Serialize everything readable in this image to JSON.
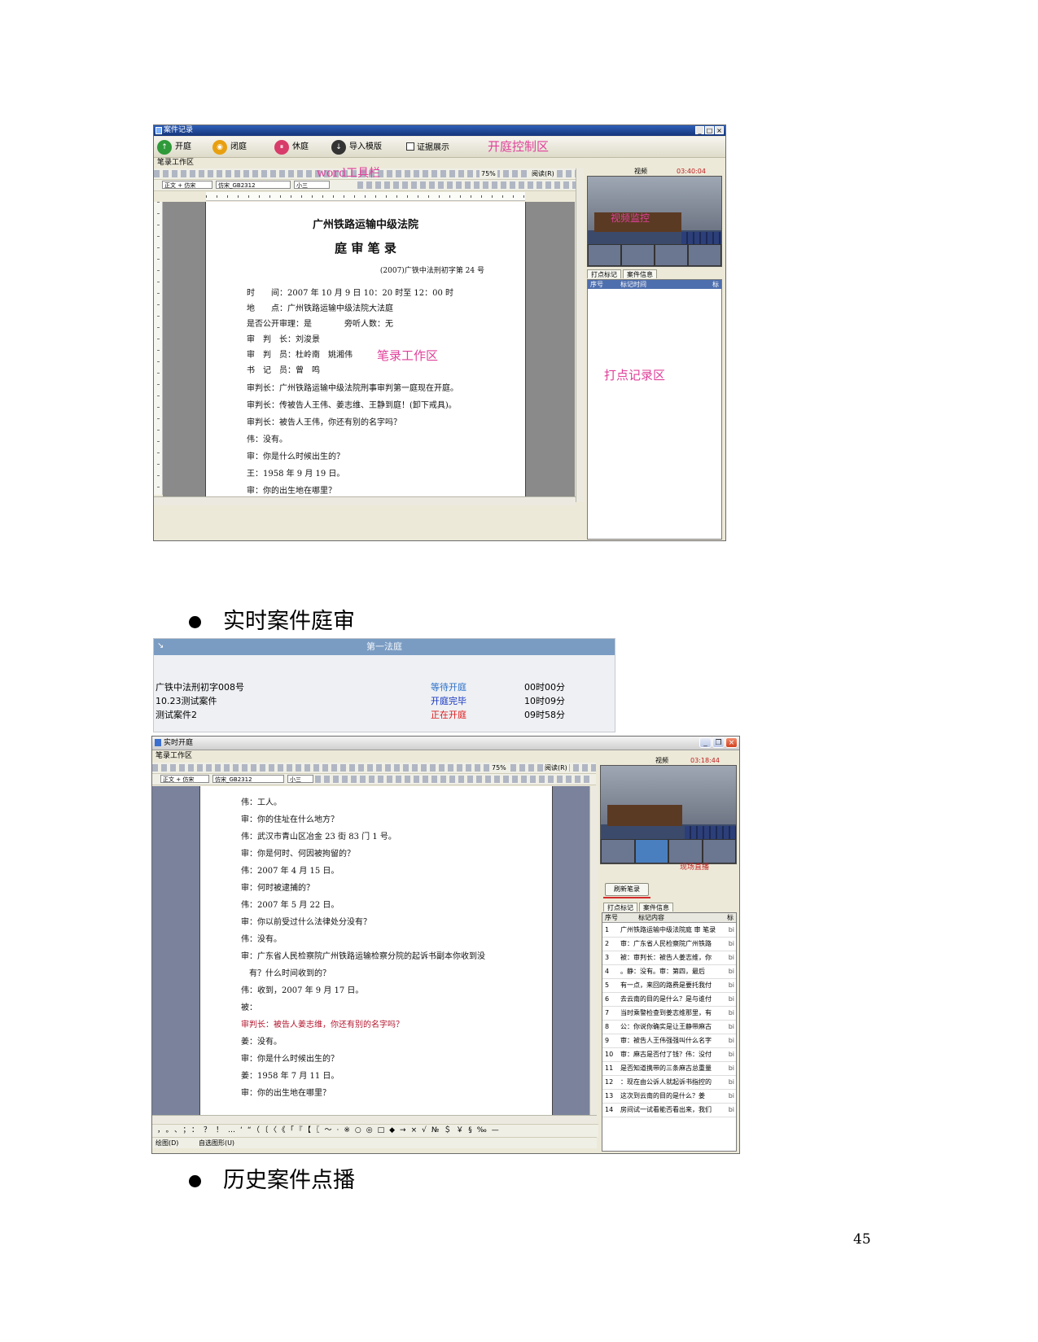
{
  "shot1": {
    "window_title": "案件记录",
    "window_buttons": [
      "_",
      "□",
      "×"
    ],
    "controls": [
      {
        "label": "开庭",
        "icon": "open-court-icon",
        "color": "#2f9a3a"
      },
      {
        "label": "闭庭",
        "icon": "close-court-icon",
        "color": "#e8a010"
      },
      {
        "label": "休庭",
        "icon": "recess-icon",
        "color": "#d83c6a"
      },
      {
        "label": "导入模版",
        "icon": "import-template-icon",
        "color": "#333333"
      }
    ],
    "evidence_checkbox": "证据展示",
    "control_area_label": "开庭控制区",
    "workarea_caption": "笔录工作区",
    "word_toolbar_label": "word工具栏",
    "toolbar_zoom": "75%",
    "toolbar_read": "阅读(R)",
    "format_style": "正文 + 仿宋",
    "format_font": "仿宋_GB2312",
    "format_size": "小三",
    "doc": {
      "court_name": "广州铁路运输中级法院",
      "doc_title": "庭 审 笔 录",
      "case_no": "(2007)广铁中法刑初字第 24 号",
      "lines": [
        "时　　间：2007 年 10 月 9 日 10：20 时至 12：00 时",
        "地　　点：广州铁路运输中级法院大法庭",
        "是否公开审理：是　　　　旁听人数：无",
        "审　判　长：刘浚景",
        "审　判　员：杜岭南　姚湘伟",
        "书　记　员：曾　鸣",
        "审判长：广州铁路运输中级法院刑事审判第一庭现在开庭。",
        "审判长：传被告人王伟、姜志维、王静到庭！(卸下戒具)。",
        "审判长：被告人王伟，你还有别的名字吗？",
        "伟：没有。",
        "审：你是什么时候出生的？",
        "王：1958 年 9 月 19 日。",
        "审：你的出生地在哪里？"
      ],
      "workarea_label": "笔录工作区"
    },
    "video_label": "视频",
    "video_time": "03:40:04",
    "video_overlay": "视频监控",
    "tabs": [
      "打点标记",
      "案件信息"
    ],
    "list_headers": [
      "序号",
      "标记时间",
      "标"
    ],
    "marker_area_label": "打点记录区"
  },
  "bullet1": "实时案件庭审",
  "court_panel": {
    "title": "第一法庭",
    "cases": [
      {
        "name": "广铁中法刑初字008号",
        "status": "等待开庭",
        "status_color": "#2a6fc9",
        "time": "00时00分"
      },
      {
        "name": "10.23测试案件",
        "status": "开庭完毕",
        "status_color": "#1030c0",
        "time": "10时09分"
      },
      {
        "name": "测试案件2",
        "status": "正在开庭",
        "status_color": "#e01818",
        "time": "09时58分"
      }
    ]
  },
  "shot2": {
    "window_title": "实时开庭",
    "workarea_caption": "笔录工作区",
    "toolbar_zoom": "75%",
    "toolbar_read": "阅读(R)",
    "format_style": "正文 + 仿宋",
    "format_font": "仿宋_GB2312",
    "format_size": "小三",
    "doc_lines": [
      "伟：工人。",
      "审：你的住址在什么地方？",
      "伟：武汉市青山区冶金 23 街 83 门 1 号。",
      "审：你是何时、何因被拘留的？",
      "伟：2007 年 4 月 15 日。",
      "审：何时被逮捕的？",
      "伟：2007 年 5 月 22 日。",
      "审：你以前受过什么法律处分没有？",
      "伟：没有。",
      "审：广东省人民检察院广州铁路运输检察分院的起诉书副本你收到没",
      "　有？什么时间收到的？",
      "伟：收到，2007 年 9 月 17 日。",
      "被：",
      "审判长：被告人姜志维，你还有别的名字吗？",
      "姜：没有。",
      "审：你是什么时候出生的？",
      "姜：1958 年 7 月 11 日。",
      "审：你的出生地在哪里？"
    ],
    "red_line_index": 13,
    "video_label": "视频",
    "video_time": "03:18:44",
    "live_label": "现场直播",
    "refresh_button": "刷新笔录",
    "tabs": [
      "打点标记",
      "案件信息"
    ],
    "list_headers": [
      "序号",
      "标记内容",
      "标"
    ],
    "markers": [
      {
        "n": "1",
        "text": "广州铁路运输中级法院庭 审 笔录"
      },
      {
        "n": "2",
        "text": "审：广东省人民检察院广州铁路"
      },
      {
        "n": "3",
        "text": "被：审判长：被告人姜志维，你"
      },
      {
        "n": "4",
        "text": "。静：没有。审：第四，最后"
      },
      {
        "n": "5",
        "text": "有一点，来回的路费是要托我付"
      },
      {
        "n": "6",
        "text": "去云南的目的是什么？是与谁付"
      },
      {
        "n": "7",
        "text": "当时乘警检查到姜志维那里，有"
      },
      {
        "n": "8",
        "text": "公：你说你确实是让王静带麻古"
      },
      {
        "n": "9",
        "text": "审：被告人王伟强强叫什么名字"
      },
      {
        "n": "10",
        "text": "审：麻古是否付了钱？伟：没付"
      },
      {
        "n": "11",
        "text": "是否知道携带的三条麻古总重量"
      },
      {
        "n": "12",
        "text": "：现在由公诉人就起诉书指控的"
      },
      {
        "n": "13",
        "text": "这次到云南的目的是什么？姜"
      },
      {
        "n": "14",
        "text": "房间试一试看能否看出来，我们"
      }
    ],
    "marker_tag": "bi",
    "symbols": "，。、；：？！…‘“（〔〈《「『【〖～·※○◎□◆→×√№＄￥§‰—",
    "draw_label": "绘图(D)",
    "autoshape_label": "自选图形(U)"
  },
  "bullet2": "历史案件点播",
  "page_number": "45"
}
